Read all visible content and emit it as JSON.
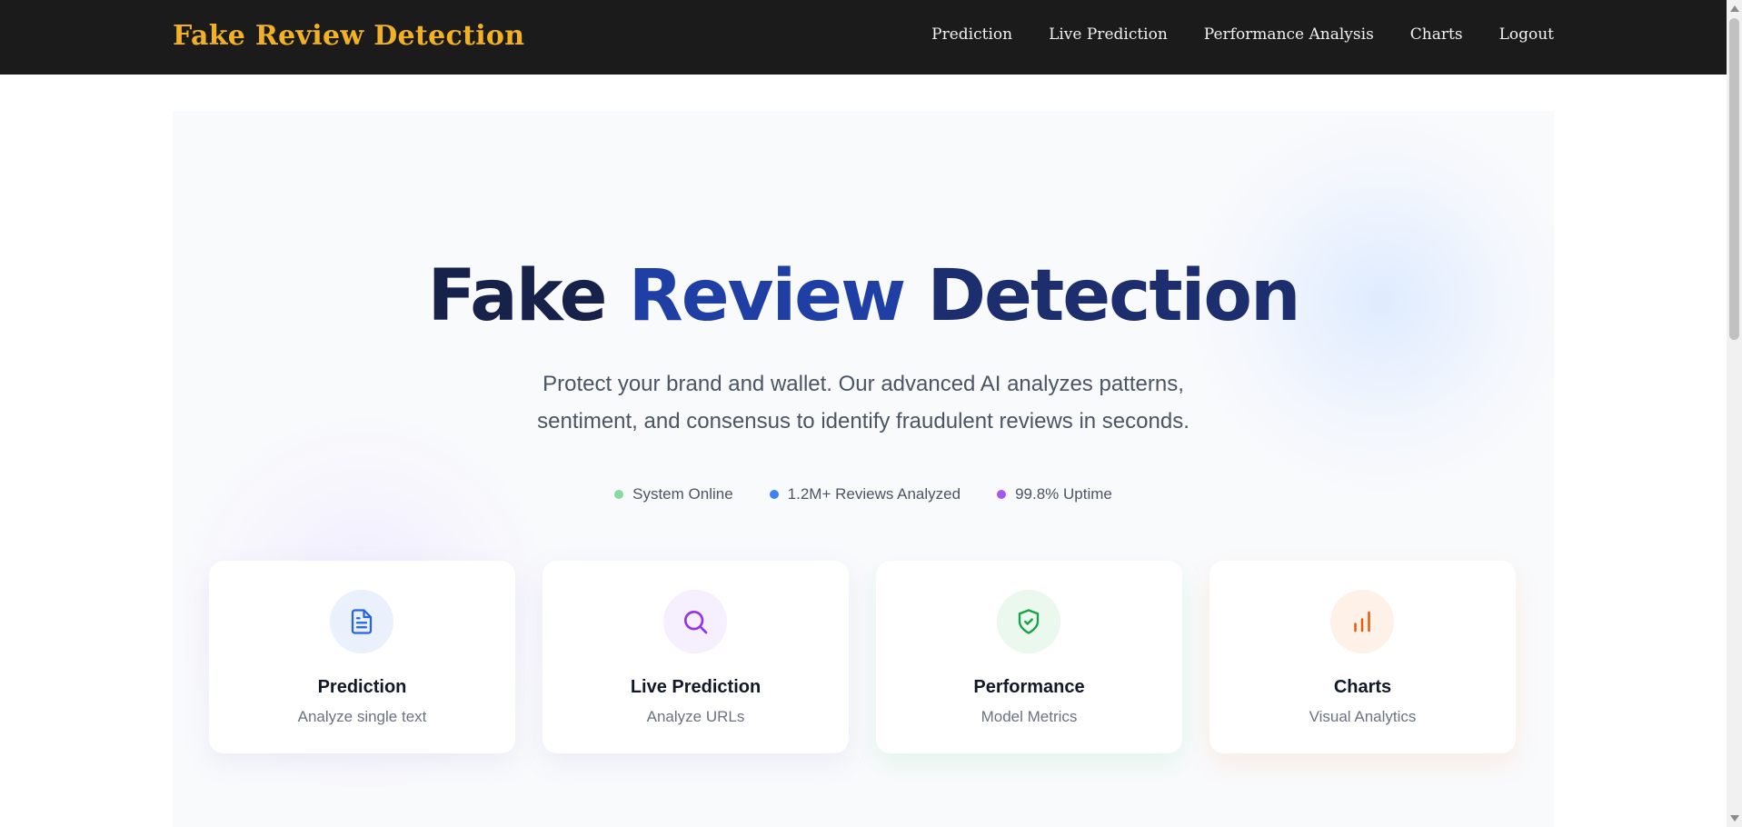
{
  "navbar": {
    "brand": "Fake Review Detection",
    "links": [
      "Prediction",
      "Live Prediction",
      "Performance Analysis",
      "Charts",
      "Logout"
    ]
  },
  "hero": {
    "title_part1": "Fake",
    "title_part2": "Review",
    "title_part3": "Detection",
    "subtitle_line1": "Protect your brand and wallet. Our advanced AI analyzes patterns,",
    "subtitle_line2": "sentiment, and consensus to identify fraudulent reviews in seconds.",
    "stats": [
      {
        "label": "System Online",
        "color": "#86d9a0"
      },
      {
        "label": "1.2M+ Reviews Analyzed",
        "color": "#3b82f6"
      },
      {
        "label": "99.8% Uptime",
        "color": "#a855f7"
      }
    ]
  },
  "cards": [
    {
      "title": "Prediction",
      "subtitle": "Analyze single text",
      "icon": "document-icon",
      "icon_color": "#2563eb",
      "icon_bg": "#eaf1fd"
    },
    {
      "title": "Live Prediction",
      "subtitle": "Analyze URLs",
      "icon": "search-icon",
      "icon_color": "#9333ea",
      "icon_bg": "#f6effd"
    },
    {
      "title": "Performance",
      "subtitle": "Model Metrics",
      "icon": "shield-check-icon",
      "icon_color": "#16a34a",
      "icon_bg": "#eaf8ee"
    },
    {
      "title": "Charts",
      "subtitle": "Visual Analytics",
      "icon": "bar-chart-icon",
      "icon_color": "#ea580c",
      "icon_bg": "#fef2e8"
    }
  ],
  "colors": {
    "brand": "#f2b124",
    "navbar_bg": "#1b1b1b",
    "title_dark": "#17224b",
    "title_blue": "#1f3fa5"
  }
}
